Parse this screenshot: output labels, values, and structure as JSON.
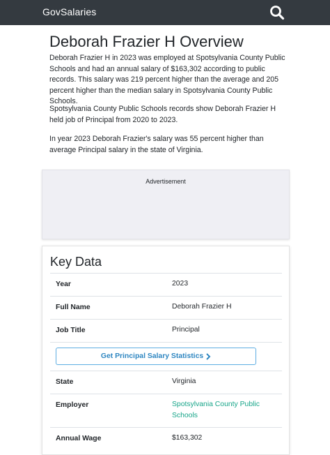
{
  "nav": {
    "brand": "GovSalaries",
    "search_icon": "search-icon"
  },
  "overview": {
    "title": "Deborah Frazier H Overview",
    "paragraphs": [
      "Deborah Frazier H in 2023 was employed at Spotsylvania County Public Schools and had an annual salary of $163,302 according to public records. This salary was 219 percent higher than the average and 205 percent higher than the median salary in Spotsylvania County Public Schools.",
      "Spotsylvania County Public Schools records show Deborah Frazier H held job of Principal from 2020 to 2023.",
      "In year 2023 Deborah Frazier's salary was 55 percent higher than average Principal salary in the state of Virginia."
    ]
  },
  "ad": {
    "label": "Advertisement"
  },
  "key_data": {
    "title": "Key Data",
    "rows": [
      {
        "label": "Year",
        "value": "2023"
      },
      {
        "label": "Full Name",
        "value": "Deborah Frazier H"
      },
      {
        "label": "Job Title",
        "value": "Principal"
      },
      {
        "label": "State",
        "value": "Virginia"
      },
      {
        "label": "Employer",
        "value": "Spotsylvania County Public Schools"
      },
      {
        "label": "Annual Wage",
        "value": "$163,302"
      }
    ],
    "stats_button": "Get Principal Salary Statistics",
    "stats_button_icon": "chevron-right-icon",
    "link_color": "#17a589"
  }
}
